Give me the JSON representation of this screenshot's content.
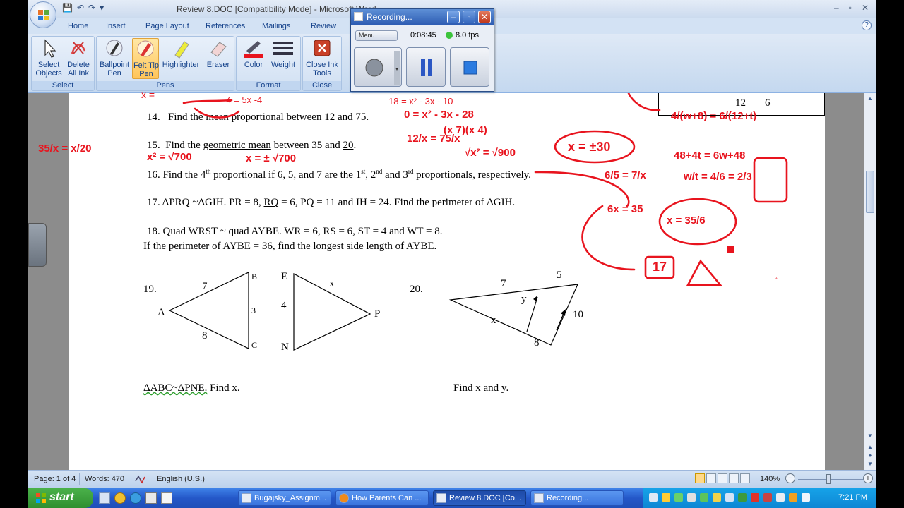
{
  "window": {
    "title": "Review 8.DOC [Compatibility Mode] - Microsoft Word",
    "controls": [
      "–",
      "▫",
      "✕"
    ]
  },
  "qat": {
    "save": "💾",
    "undo": "↶",
    "redo": "↷",
    "more": "▾"
  },
  "tabs": [
    "Home",
    "Insert",
    "Page Layout",
    "References",
    "Mailings",
    "Review"
  ],
  "help": "?",
  "ribbon": {
    "select_group": {
      "label": "Select",
      "buttons": [
        "Select Objects",
        "Delete All Ink"
      ]
    },
    "pens_group": {
      "label": "Pens",
      "buttons": [
        "Ballpoint Pen",
        "Felt Tip Pen",
        "Highlighter",
        "Eraser"
      ]
    },
    "format_group": {
      "label": "Format",
      "buttons": [
        "Color",
        "Weight"
      ]
    },
    "close_group": {
      "label": "Close",
      "buttons": [
        "Close Ink Tools"
      ]
    }
  },
  "recorder": {
    "title": "Recording...",
    "menu": "Menu",
    "time": "0:08:45",
    "fps": "8.0 fps",
    "status_color": "#3cc43c"
  },
  "document": {
    "top_fragments": {
      "left": "x = ",
      "mid": "-4 = 5x  -4",
      "right": "18 = x² - 3x - 10",
      "table_12": "12",
      "table_6": "6"
    },
    "q14": {
      "num": "14.",
      "text_a": "Find the ",
      "link": "mean proportional",
      "text_b": " between ",
      "n1": "12",
      "and": " and ",
      "n2": "75",
      "end": "."
    },
    "q15": {
      "num": "15.",
      "text_a": "Find the ",
      "link": "geometric mean",
      "text_b": " between 35 and ",
      "n2": "20",
      "end": "."
    },
    "q16": {
      "text": "16.  Find the 4",
      "sup1": "th",
      "text2": " proportional if 6, 5, and 7 are the 1",
      "sup2": "st",
      "text3": ", 2",
      "sup3": "nd",
      "text4": " and 3",
      "sup4": "rd",
      "text5": " proportionals, respectively."
    },
    "q17": {
      "text_a": "17.   ΔPRQ ~ΔGIH.  PR = 8, ",
      "rq": " RQ",
      "text_b": " = 6,  PQ = 11 and IH = 24.  Find the perimeter of ΔGIH."
    },
    "q18": {
      "line1": "18.   Quad WRST ~ quad AYBE.  WR = 6, RS = 6, ST = 4 and WT = 8.",
      "line2_a": "If the perimeter of AYBE = 36, ",
      "line2_link": " find",
      "line2_b": " the longest side length of AYBE."
    },
    "q19": {
      "num": "19.",
      "labels": {
        "A": "A",
        "B": "B",
        "C": "C",
        "E": "E",
        "N": "N",
        "P": "P",
        "s7": "7",
        "s8": "8",
        "s3": "3",
        "s4": "4",
        "sx": "x"
      },
      "caption": "ΔABC~ΔPNE.",
      "caption_b": "  Find x."
    },
    "q20": {
      "num": "20.",
      "labels": {
        "s7": "7",
        "s5": "5",
        "sy": "y",
        "sx": "x",
        "s10": "10",
        "s8": "8"
      },
      "caption": "Find x and y."
    },
    "ink": {
      "color": "#e8141e",
      "notes": [
        "35/x = x/20",
        "x² = √700",
        "x = ± √700",
        "12/x = 75/x",
        "√x² = √900",
        "x = ±30",
        "0 = x² - 3x - 28",
        "(x 7)(x 4)",
        "6/5 = 7/x",
        "6x = 35",
        "x = 35/6",
        "17",
        "Δ",
        "4/(w+8) = 6/(12+t)",
        "48+4t = 6w+48",
        "w/t = 4/6 = 2/3"
      ]
    }
  },
  "status": {
    "page": "Page: 1 of 4",
    "words": "Words: 470",
    "language": "English (U.S.)",
    "zoom": "140%"
  },
  "taskbar": {
    "start": "start",
    "tasks": [
      "Bugajsky_Assignm...",
      "How Parents Can ...",
      "Review 8.DOC [Co...",
      "Recording..."
    ],
    "clock": "7:21 PM"
  }
}
